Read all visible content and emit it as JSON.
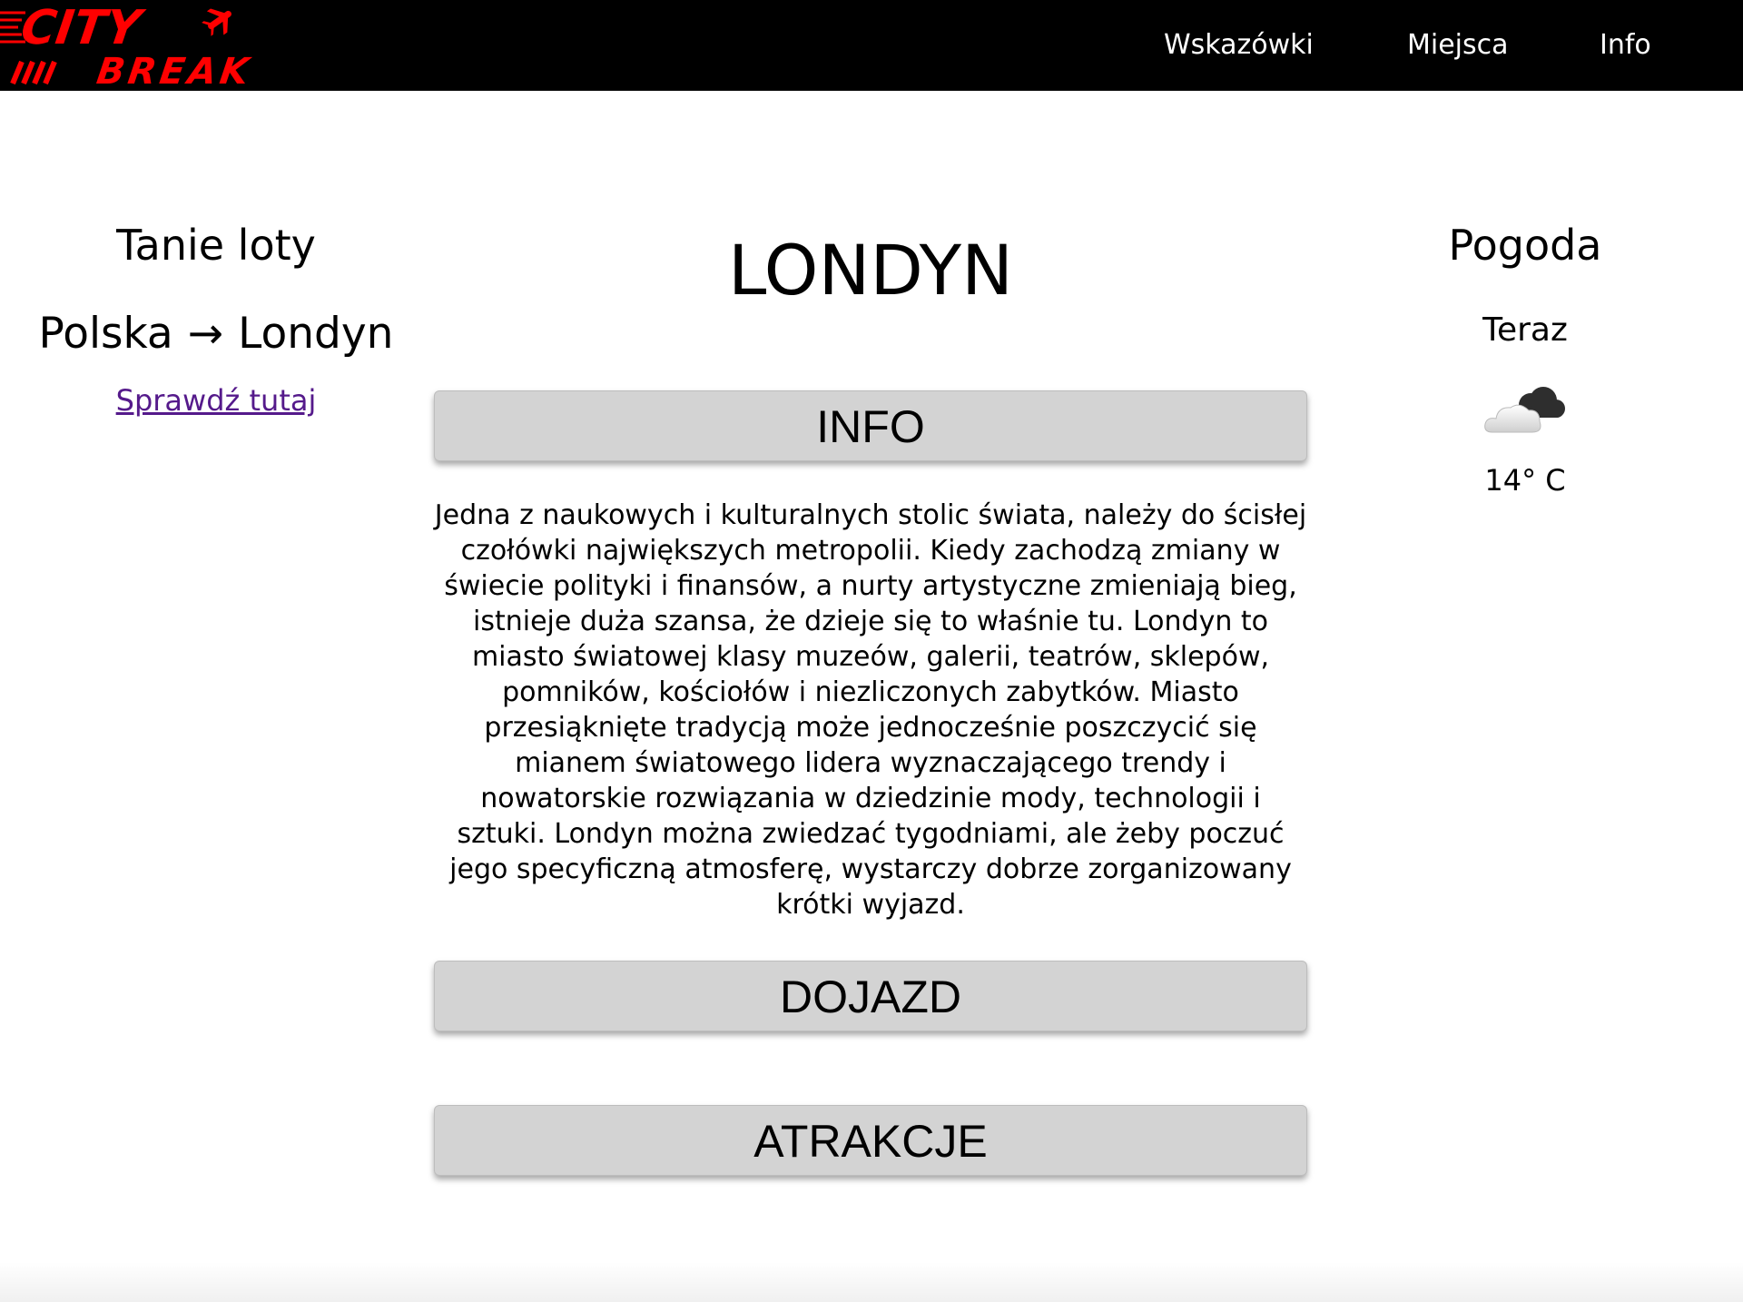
{
  "logo": {
    "text_top": "CITY",
    "text_bottom": "BREAK",
    "icon": "airplane-icon",
    "color": "#ff0000"
  },
  "nav": {
    "items": [
      "Wskazówki",
      "Miejsca",
      "Info"
    ]
  },
  "flights": {
    "heading": "Tanie loty",
    "from": "Polska",
    "arrow": "→",
    "to": "Londyn",
    "link_label": "Sprawdź tutaj"
  },
  "city": {
    "title": "LONDYN"
  },
  "sections": {
    "info": "INFO",
    "dojazd": "DOJAZD",
    "atrakcje": "ATRAKCJE"
  },
  "info_text": "Jedna z naukowych i kulturalnych stolic świata, należy do ścisłej czołówki największych metropolii. Kiedy zachodzą zmiany w świecie polityki i finansów, a nurty artystyczne zmieniają bieg, istnieje duża szansa, że dzieje się to właśnie tu. Londyn to miasto światowej klasy muzeów, galerii, teatrów, sklepów, pomników, kościołów i niezliczonych zabytków. Miasto przesiąknięte tradycją może jednocześnie poszczycić się mianem światowego lidera wyznaczającego trendy i nowatorskie rozwiązania w dziedzinie mody, technologii i sztuki. Londyn można zwiedzać tygodniami, ale żeby poczuć jego specyficzną atmosferę, wystarczy dobrze zorganizowany krótki wyjazd.",
  "weather": {
    "heading": "Pogoda",
    "now_label": "Teraz",
    "icon": "cloudy-icon",
    "temperature": "14° C"
  },
  "colors": {
    "navbar_bg": "#000000",
    "button_bg": "#d3d3d3",
    "link": "#551a8b"
  }
}
